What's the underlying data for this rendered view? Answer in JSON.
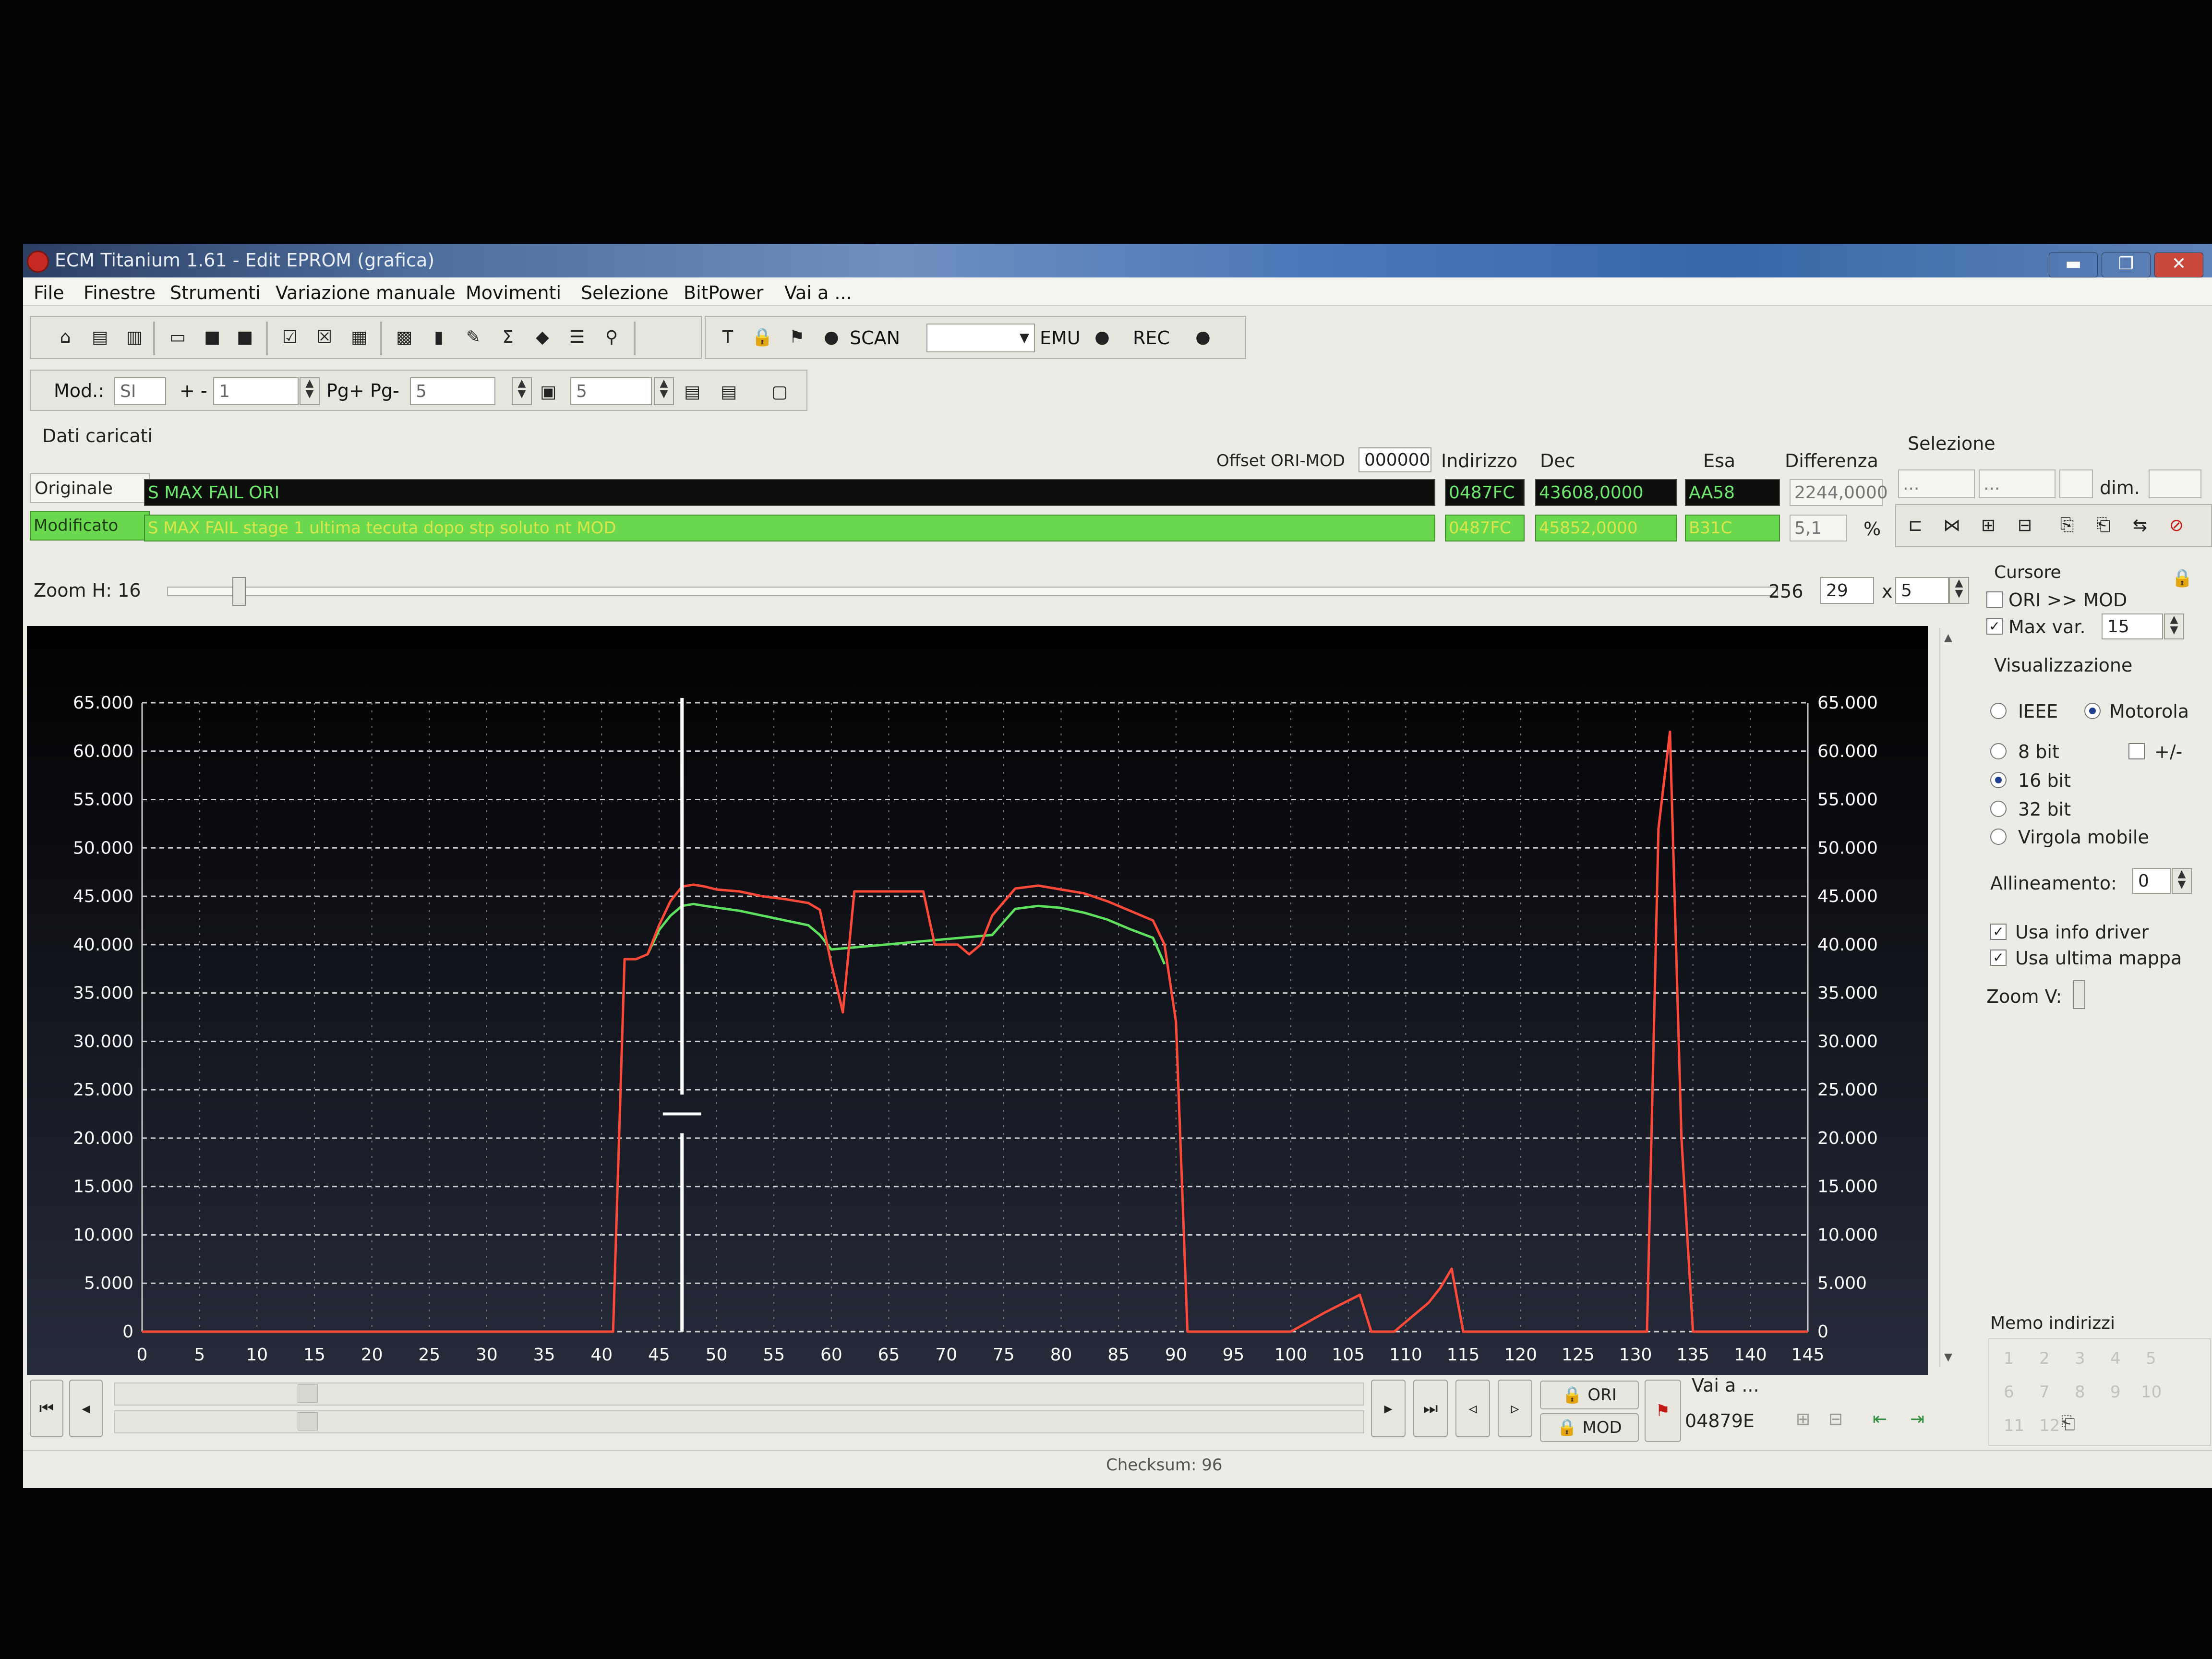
{
  "window": {
    "title": "ECM Titanium 1.61 - Edit EPROM (grafica)",
    "min": "▬",
    "max": "❐",
    "close": "✕"
  },
  "menu": [
    "File",
    "Finestre",
    "Strumenti",
    "Variazione manuale",
    "Movimenti",
    "Selezione",
    "BitPower",
    "Vai a ..."
  ],
  "toolbar": {
    "scan_label": "SCAN",
    "emu_label": "EMU",
    "rec_label": "REC"
  },
  "toolbar2": {
    "mod_label": "Mod.:",
    "mod_value": "SI",
    "plusminus_label": "+ -",
    "plusminus_value": "1",
    "pg_label": "Pg+ Pg-",
    "pg_value": "5",
    "p_value": "5"
  },
  "dati": {
    "section_label": "Dati caricati",
    "offset_label": "Offset ORI-MOD",
    "offset_value": "000000",
    "col_indirizzo": "Indirizzo",
    "col_dec": "Dec",
    "col_esa": "Esa",
    "col_differenza": "Differenza",
    "originale_label": "Originale",
    "originale_name": "S MAX FAIL ORI",
    "originale_indirizzo": "0487FC",
    "originale_dec": "43608,0000",
    "originale_esa": "AA58",
    "differenza_value": "2244,0000",
    "modificato_label": "Modificato",
    "modificato_name": "S MAX FAIL stage 1 ultima tecuta dopo stp soluto nt MOD",
    "modificato_indirizzo": "0487FC",
    "modificato_dec": "45852,0000",
    "modificato_esa": "B31C",
    "percent_value": "5,1",
    "percent_sign": "%"
  },
  "selezione": {
    "label": "Selezione",
    "field1": "...",
    "field2": "...",
    "dim_label": "dim."
  },
  "zoom": {
    "label": "Zoom H: 16",
    "value": "256",
    "cols": "29",
    "x_sign": "x",
    "rows": "5"
  },
  "sidebar": {
    "cursore_label": "Cursore",
    "ori_mod_label": "ORI >> MOD",
    "ori_mod_checked": false,
    "maxvar_label": "Max var.",
    "maxvar_checked": true,
    "maxvar_value": "15",
    "visualizzazione_label": "Visualizzazione",
    "ieee_label": "IEEE",
    "motorola_label": "Motorola",
    "bit8_label": "8 bit",
    "plusminus_label": "+/-",
    "bit16_label": "16 bit",
    "bit32_label": "32 bit",
    "virgola_label": "Virgola mobile",
    "allineamento_label": "Allineamento:",
    "allineamento_value": "0",
    "usa_info_label": "Usa info driver",
    "usa_ultima_label": "Usa ultima mappa",
    "zoomv_label": "Zoom V:",
    "memo_label": "Memo indirizzi",
    "memo_numbers": [
      "1",
      "2",
      "3",
      "4",
      "5",
      "6",
      "7",
      "8",
      "9",
      "10",
      "11",
      "12"
    ]
  },
  "bottom": {
    "ori_label": "ORI",
    "mod_label": "MOD",
    "vai_label": "Vai a ...",
    "vai_value": "04879E"
  },
  "status": {
    "checksum": "Checksum: 96"
  },
  "colors": {
    "ori_line": "#ff4a3a",
    "mod_line": "#5fe05f",
    "grid": "#cfcfcf",
    "cursor": "#ffffff"
  },
  "chart_data": {
    "type": "line",
    "title": "",
    "xlabel": "",
    "ylabel": "",
    "xlim": [
      0,
      145
    ],
    "ylim": [
      0,
      65000
    ],
    "x_ticks": [
      0,
      5,
      10,
      15,
      20,
      25,
      30,
      35,
      40,
      45,
      50,
      55,
      60,
      65,
      70,
      75,
      80,
      85,
      90,
      95,
      100,
      105,
      110,
      115,
      120,
      125,
      130,
      135,
      140,
      145
    ],
    "y_ticks": [
      0,
      5000,
      10000,
      15000,
      20000,
      25000,
      30000,
      35000,
      40000,
      45000,
      50000,
      55000,
      60000,
      65000
    ],
    "y_tick_labels": [
      "0",
      "5.000",
      "10.000",
      "15.000",
      "20.000",
      "25.000",
      "30.000",
      "35.000",
      "40.000",
      "45.000",
      "50.000",
      "55.000",
      "60.000",
      "65.000"
    ],
    "y_tick_labels_right": [
      "0",
      "5.000",
      "10.000",
      "15.000",
      "20.000",
      "25.000",
      "30.000",
      "35.000",
      "40.000",
      "45.000",
      "50.000",
      "55.000",
      "60.000",
      "65.000"
    ],
    "grid": true,
    "cursor_x": 47,
    "series": [
      {
        "key": "red",
        "color": "#ff4a3a",
        "points": [
          [
            0,
            0
          ],
          [
            41,
            0
          ],
          [
            42,
            38500
          ],
          [
            43,
            38500
          ],
          [
            44,
            39000
          ],
          [
            45,
            42000
          ],
          [
            46,
            44500
          ],
          [
            47,
            46000
          ],
          [
            48,
            46200
          ],
          [
            49,
            46000
          ],
          [
            50,
            45700
          ],
          [
            52,
            45500
          ],
          [
            54,
            45000
          ],
          [
            56,
            44700
          ],
          [
            58,
            44300
          ],
          [
            59,
            43600
          ],
          [
            60,
            38000
          ],
          [
            61,
            33000
          ],
          [
            62,
            45500
          ],
          [
            63,
            45500
          ],
          [
            65,
            45500
          ],
          [
            68,
            45500
          ],
          [
            69,
            40000
          ],
          [
            71,
            40000
          ],
          [
            72,
            39000
          ],
          [
            73,
            40000
          ],
          [
            74,
            43000
          ],
          [
            76,
            45800
          ],
          [
            78,
            46100
          ],
          [
            80,
            45700
          ],
          [
            82,
            45300
          ],
          [
            84,
            44500
          ],
          [
            86,
            43500
          ],
          [
            88,
            42500
          ],
          [
            89,
            40000
          ],
          [
            90,
            32000
          ],
          [
            91,
            0
          ],
          [
            98,
            0
          ],
          [
            100,
            0
          ],
          [
            103,
            2000
          ],
          [
            106,
            3800
          ],
          [
            107,
            0
          ],
          [
            109,
            0
          ],
          [
            112,
            3000
          ],
          [
            113,
            4500
          ],
          [
            114,
            6500
          ],
          [
            115,
            0
          ],
          [
            130,
            0
          ],
          [
            131,
            0
          ],
          [
            132,
            52000
          ],
          [
            133,
            62000
          ],
          [
            134,
            20000
          ],
          [
            135,
            0
          ],
          [
            145,
            0
          ]
        ]
      },
      {
        "key": "green",
        "color": "#5fe05f",
        "points": [
          [
            44,
            39000
          ],
          [
            45,
            41500
          ],
          [
            46,
            43000
          ],
          [
            47,
            44000
          ],
          [
            48,
            44200
          ],
          [
            49,
            44000
          ],
          [
            52,
            43500
          ],
          [
            54,
            43000
          ],
          [
            56,
            42500
          ],
          [
            58,
            42000
          ],
          [
            59,
            41000
          ],
          [
            60,
            39500
          ],
          [
            74,
            41000
          ],
          [
            76,
            43700
          ],
          [
            78,
            44000
          ],
          [
            80,
            43800
          ],
          [
            82,
            43300
          ],
          [
            84,
            42600
          ],
          [
            86,
            41600
          ],
          [
            88,
            40700
          ],
          [
            89,
            38000
          ]
        ]
      }
    ]
  }
}
